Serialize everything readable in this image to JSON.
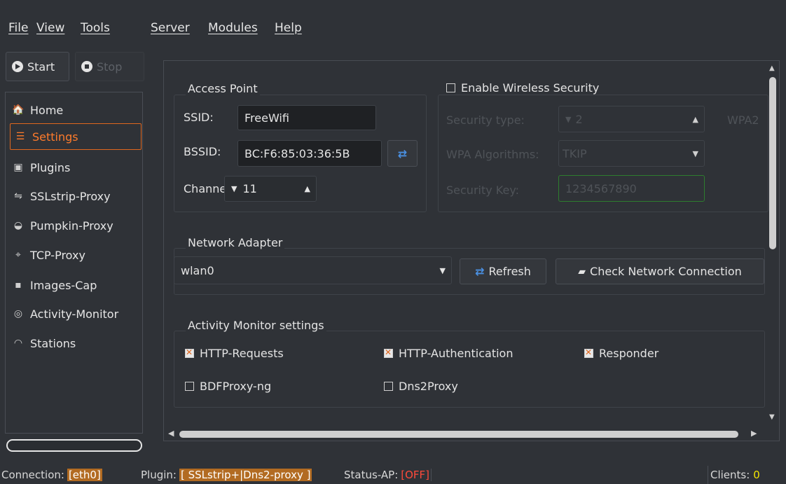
{
  "menu": [
    "File",
    "View",
    "Tools",
    "Server",
    "Modules",
    "Help"
  ],
  "toolbar": {
    "start_label": "Start",
    "stop_label": "Stop"
  },
  "sidebar": {
    "items": [
      {
        "label": "Home",
        "icon": "home-icon"
      },
      {
        "label": "Settings",
        "icon": "settings-icon",
        "active": true
      },
      {
        "label": "Plugins",
        "icon": "plugins-icon"
      },
      {
        "label": "SSLstrip-Proxy",
        "icon": "proxy-icon"
      },
      {
        "label": "Pumpkin-Proxy",
        "icon": "pumpkin-icon"
      },
      {
        "label": "TCP-Proxy",
        "icon": "tcp-icon"
      },
      {
        "label": "Images-Cap",
        "icon": "camera-icon"
      },
      {
        "label": "Activity-Monitor",
        "icon": "eye-icon"
      },
      {
        "label": "Stations",
        "icon": "wifi-icon"
      }
    ]
  },
  "access_point": {
    "title": "Access Point",
    "ssid_label": "SSID:",
    "ssid_value": "FreeWifi",
    "bssid_label": "BSSID:",
    "bssid_value": "BC:F6:85:03:36:5B",
    "channel_label": "Channel:",
    "channel_value": "11"
  },
  "wireless_security": {
    "title": "Enable Wireless Security",
    "enabled": false,
    "security_type_label": "Security type:",
    "security_type_value": "2",
    "security_type_text": "WPA2",
    "wpa_algorithms_label": "WPA Algorithms:",
    "wpa_algorithms_value": "TKIP",
    "security_key_label": "Security Key:",
    "security_key_value": "1234567890"
  },
  "network_adapter": {
    "title": "Network Adapter",
    "selected": "wlan0",
    "refresh_label": "Refresh",
    "check_label": "Check Network Connection"
  },
  "activity_monitor": {
    "title": "Activity Monitor settings",
    "options": [
      {
        "label": "HTTP-Requests",
        "checked": true
      },
      {
        "label": "HTTP-Authentication",
        "checked": true
      },
      {
        "label": "Responder",
        "checked": true
      },
      {
        "label": "BDFProxy-ng",
        "checked": false
      },
      {
        "label": "Dns2Proxy",
        "checked": false
      }
    ]
  },
  "status": {
    "connection_label": "Connection:",
    "connection_value": "[eth0]",
    "plugin_label": "Plugin:",
    "plugin_value": "[ SSLstrip+|Dns2-proxy ]",
    "ap_label": "Status-AP:",
    "ap_value": "[OFF]",
    "clients_label": "Clients:",
    "clients_value": "0"
  },
  "colors": {
    "accent": "#e0671e",
    "off": "#ff4a3a",
    "clients": "#f2e500",
    "highlight": "#b26b22"
  }
}
